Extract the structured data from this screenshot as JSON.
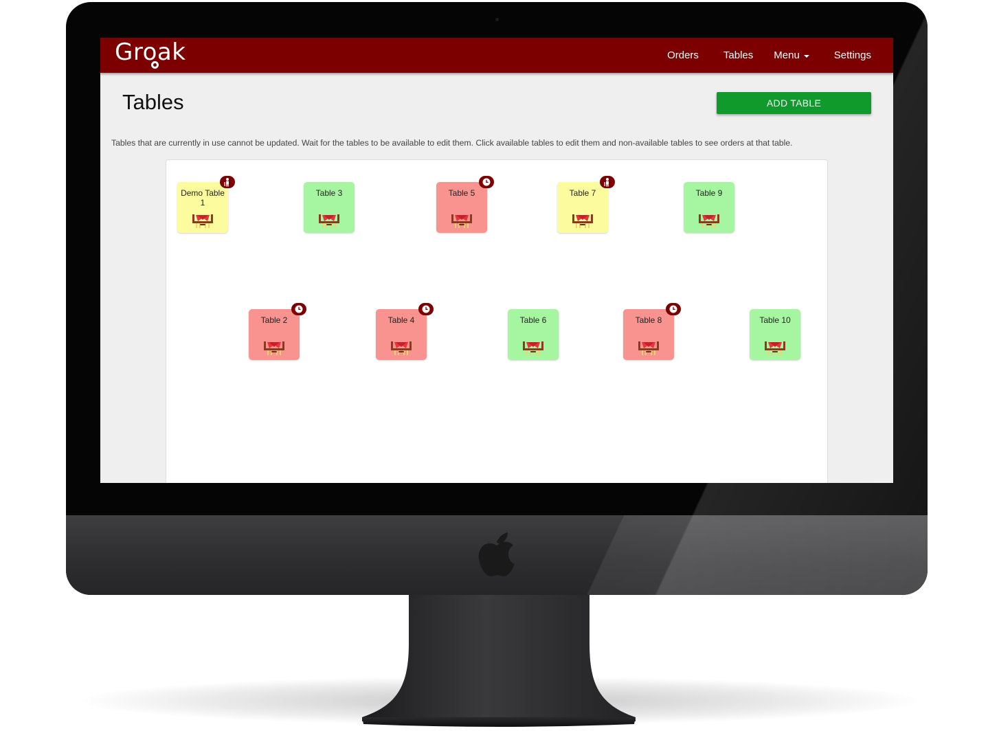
{
  "navbar": {
    "brand": "Groak",
    "links": [
      "Orders",
      "Tables",
      "Menu",
      "Settings"
    ]
  },
  "page": {
    "title": "Tables",
    "add_button": "ADD TABLE",
    "info": "Tables that are currently in use cannot be updated. Wait for the tables to be available to edit them. Click available tables to edit them and non-available tables to see orders at that table."
  },
  "colors": {
    "brand": "#7d0000",
    "add_button": "#109a2c",
    "available": "#a6f6a1",
    "occupied": "#f8938f",
    "reserved": "#fcfc9e"
  },
  "tables": [
    {
      "label": "Demo Table 1",
      "status": "reserved",
      "badge": "person-icon"
    },
    {
      "label": "Table 3",
      "status": "available",
      "badge": ""
    },
    {
      "label": "Table 5",
      "status": "occupied",
      "badge": "clock-icon"
    },
    {
      "label": "Table 7",
      "status": "reserved",
      "badge": "person-icon"
    },
    {
      "label": "Table 9",
      "status": "available",
      "badge": ""
    },
    {
      "label": "Table 2",
      "status": "occupied",
      "badge": "clock-icon"
    },
    {
      "label": "Table 4",
      "status": "occupied",
      "badge": "clock-icon"
    },
    {
      "label": "Table 6",
      "status": "available",
      "badge": ""
    },
    {
      "label": "Table 8",
      "status": "occupied",
      "badge": "clock-icon"
    },
    {
      "label": "Table 10",
      "status": "available",
      "badge": ""
    }
  ]
}
